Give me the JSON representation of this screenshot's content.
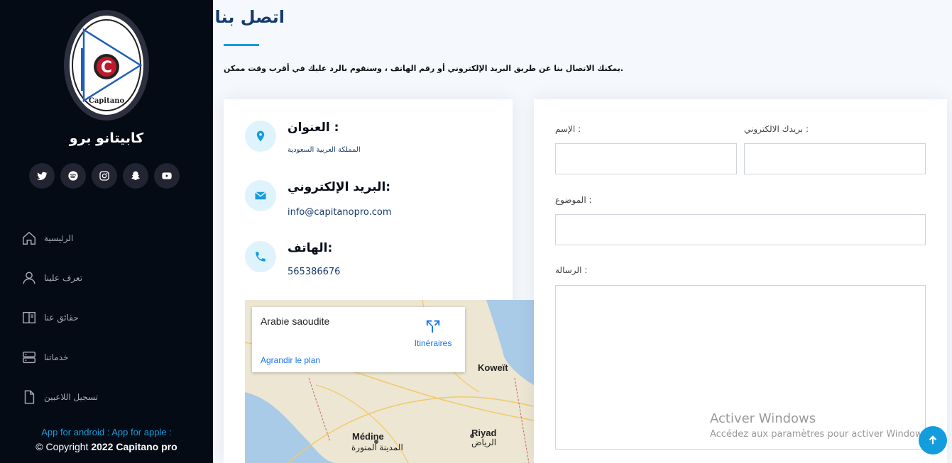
{
  "sidebar": {
    "brand": "كابيتانو برو",
    "logo_text": "Capitanopro",
    "logo_letter": "C",
    "socials": [
      {
        "icon": "twitter-icon"
      },
      {
        "icon": "spotify-icon"
      },
      {
        "icon": "instagram-icon"
      },
      {
        "icon": "snapchat-icon"
      },
      {
        "icon": "youtube-icon"
      }
    ],
    "nav": [
      {
        "label": "الرئيسية",
        "icon": "home-icon"
      },
      {
        "label": "تعرف علينا",
        "icon": "user-icon"
      },
      {
        "label": "حقائق عنا",
        "icon": "columns-icon"
      },
      {
        "label": "خدماتنا",
        "icon": "server-icon"
      },
      {
        "label": "تسجيل اللاعبين",
        "icon": "file-icon"
      }
    ],
    "apps_text": "App for android : App for apple :",
    "copyright_prefix": "© Copyright",
    "copyright_strong": "2022 Capitano pro"
  },
  "main": {
    "title": "اتصل بنا",
    "intro": "يمكنك الاتصال بنا عن طريق البريد الإلكتروني أو رقم الهاتف ، وسنقوم بالرد عليك في أقرب وقت ممكن.",
    "address_head": "العنوان :",
    "address_value": "المملكة العربية السعودية",
    "email_head": "البريد الإلكتروني:",
    "email_value": "info@capitanopro.com",
    "phone_head": "الهاتف:",
    "phone_value": "565386676",
    "map": {
      "place": "Arabie saoudite",
      "directions": "Itinéraires",
      "enlarge": "Agrandir le plan",
      "label_koweit": "Koweït",
      "label_medine": "Médine",
      "label_medine_ar": "المدينة المنورة",
      "label_riyad": "Riyad",
      "label_riyad_ar": "الرياض"
    },
    "form": {
      "name_label": "الإسم :",
      "email_label": "بريدك الالكتروني :",
      "subject_label": "الموضوع :",
      "message_label": "الرسالة :"
    }
  },
  "overlay": {
    "windows_title": "Activer Windows",
    "windows_sub": "Accédez aux paramètres pour activer Windows."
  },
  "colors": {
    "accent": "#149ddd",
    "sidebar_bg": "#040b14",
    "heading": "#173b6c"
  }
}
